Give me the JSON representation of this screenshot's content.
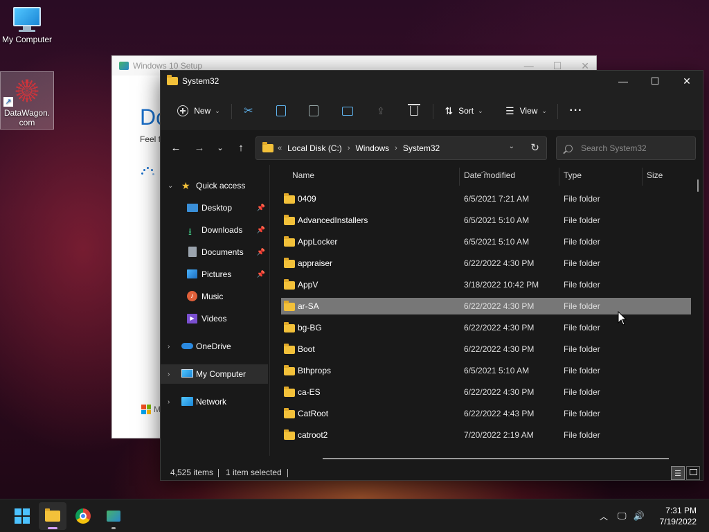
{
  "desktop": {
    "icons": [
      {
        "label": "My Computer"
      },
      {
        "label": "DataWagon.com"
      }
    ]
  },
  "setup_window": {
    "title": "Windows 10 Setup",
    "heading": "Do",
    "subtext": "Feel fr",
    "footer_text": "M"
  },
  "explorer": {
    "title": "System32",
    "toolbar": {
      "new_label": "New",
      "sort_label": "Sort",
      "view_label": "View",
      "more_label": "···"
    },
    "address": {
      "overflow": "«",
      "crumbs": [
        "Local Disk (C:)",
        "Windows",
        "System32"
      ]
    },
    "search": {
      "placeholder": "Search System32"
    },
    "nav": {
      "quick_access": "Quick access",
      "desktop": "Desktop",
      "downloads": "Downloads",
      "documents": "Documents",
      "pictures": "Pictures",
      "music": "Music",
      "videos": "Videos",
      "onedrive": "OneDrive",
      "my_computer": "My Computer",
      "network": "Network"
    },
    "columns": {
      "name": "Name",
      "date": "Date modified",
      "type": "Type",
      "size": "Size"
    },
    "rows": [
      {
        "name": "0409",
        "date": "6/5/2021 7:21 AM",
        "type": "File folder"
      },
      {
        "name": "AdvancedInstallers",
        "date": "6/5/2021 5:10 AM",
        "type": "File folder"
      },
      {
        "name": "AppLocker",
        "date": "6/5/2021 5:10 AM",
        "type": "File folder"
      },
      {
        "name": "appraiser",
        "date": "6/22/2022 4:30 PM",
        "type": "File folder"
      },
      {
        "name": "AppV",
        "date": "3/18/2022 10:42 PM",
        "type": "File folder"
      },
      {
        "name": "ar-SA",
        "date": "6/22/2022 4:30 PM",
        "type": "File folder"
      },
      {
        "name": "bg-BG",
        "date": "6/22/2022 4:30 PM",
        "type": "File folder"
      },
      {
        "name": "Boot",
        "date": "6/22/2022 4:30 PM",
        "type": "File folder"
      },
      {
        "name": "Bthprops",
        "date": "6/5/2021 5:10 AM",
        "type": "File folder"
      },
      {
        "name": "ca-ES",
        "date": "6/22/2022 4:30 PM",
        "type": "File folder"
      },
      {
        "name": "CatRoot",
        "date": "6/22/2022 4:43 PM",
        "type": "File folder"
      },
      {
        "name": "catroot2",
        "date": "7/20/2022 2:19 AM",
        "type": "File folder"
      }
    ],
    "status": {
      "count": "4,525 items",
      "selected": "1 item selected"
    }
  },
  "taskbar": {
    "time": "7:31 PM",
    "date": "7/19/2022"
  },
  "colors": {
    "accent": "#4cc2ff",
    "folder": "#f3c13a",
    "selection": "#777777"
  }
}
